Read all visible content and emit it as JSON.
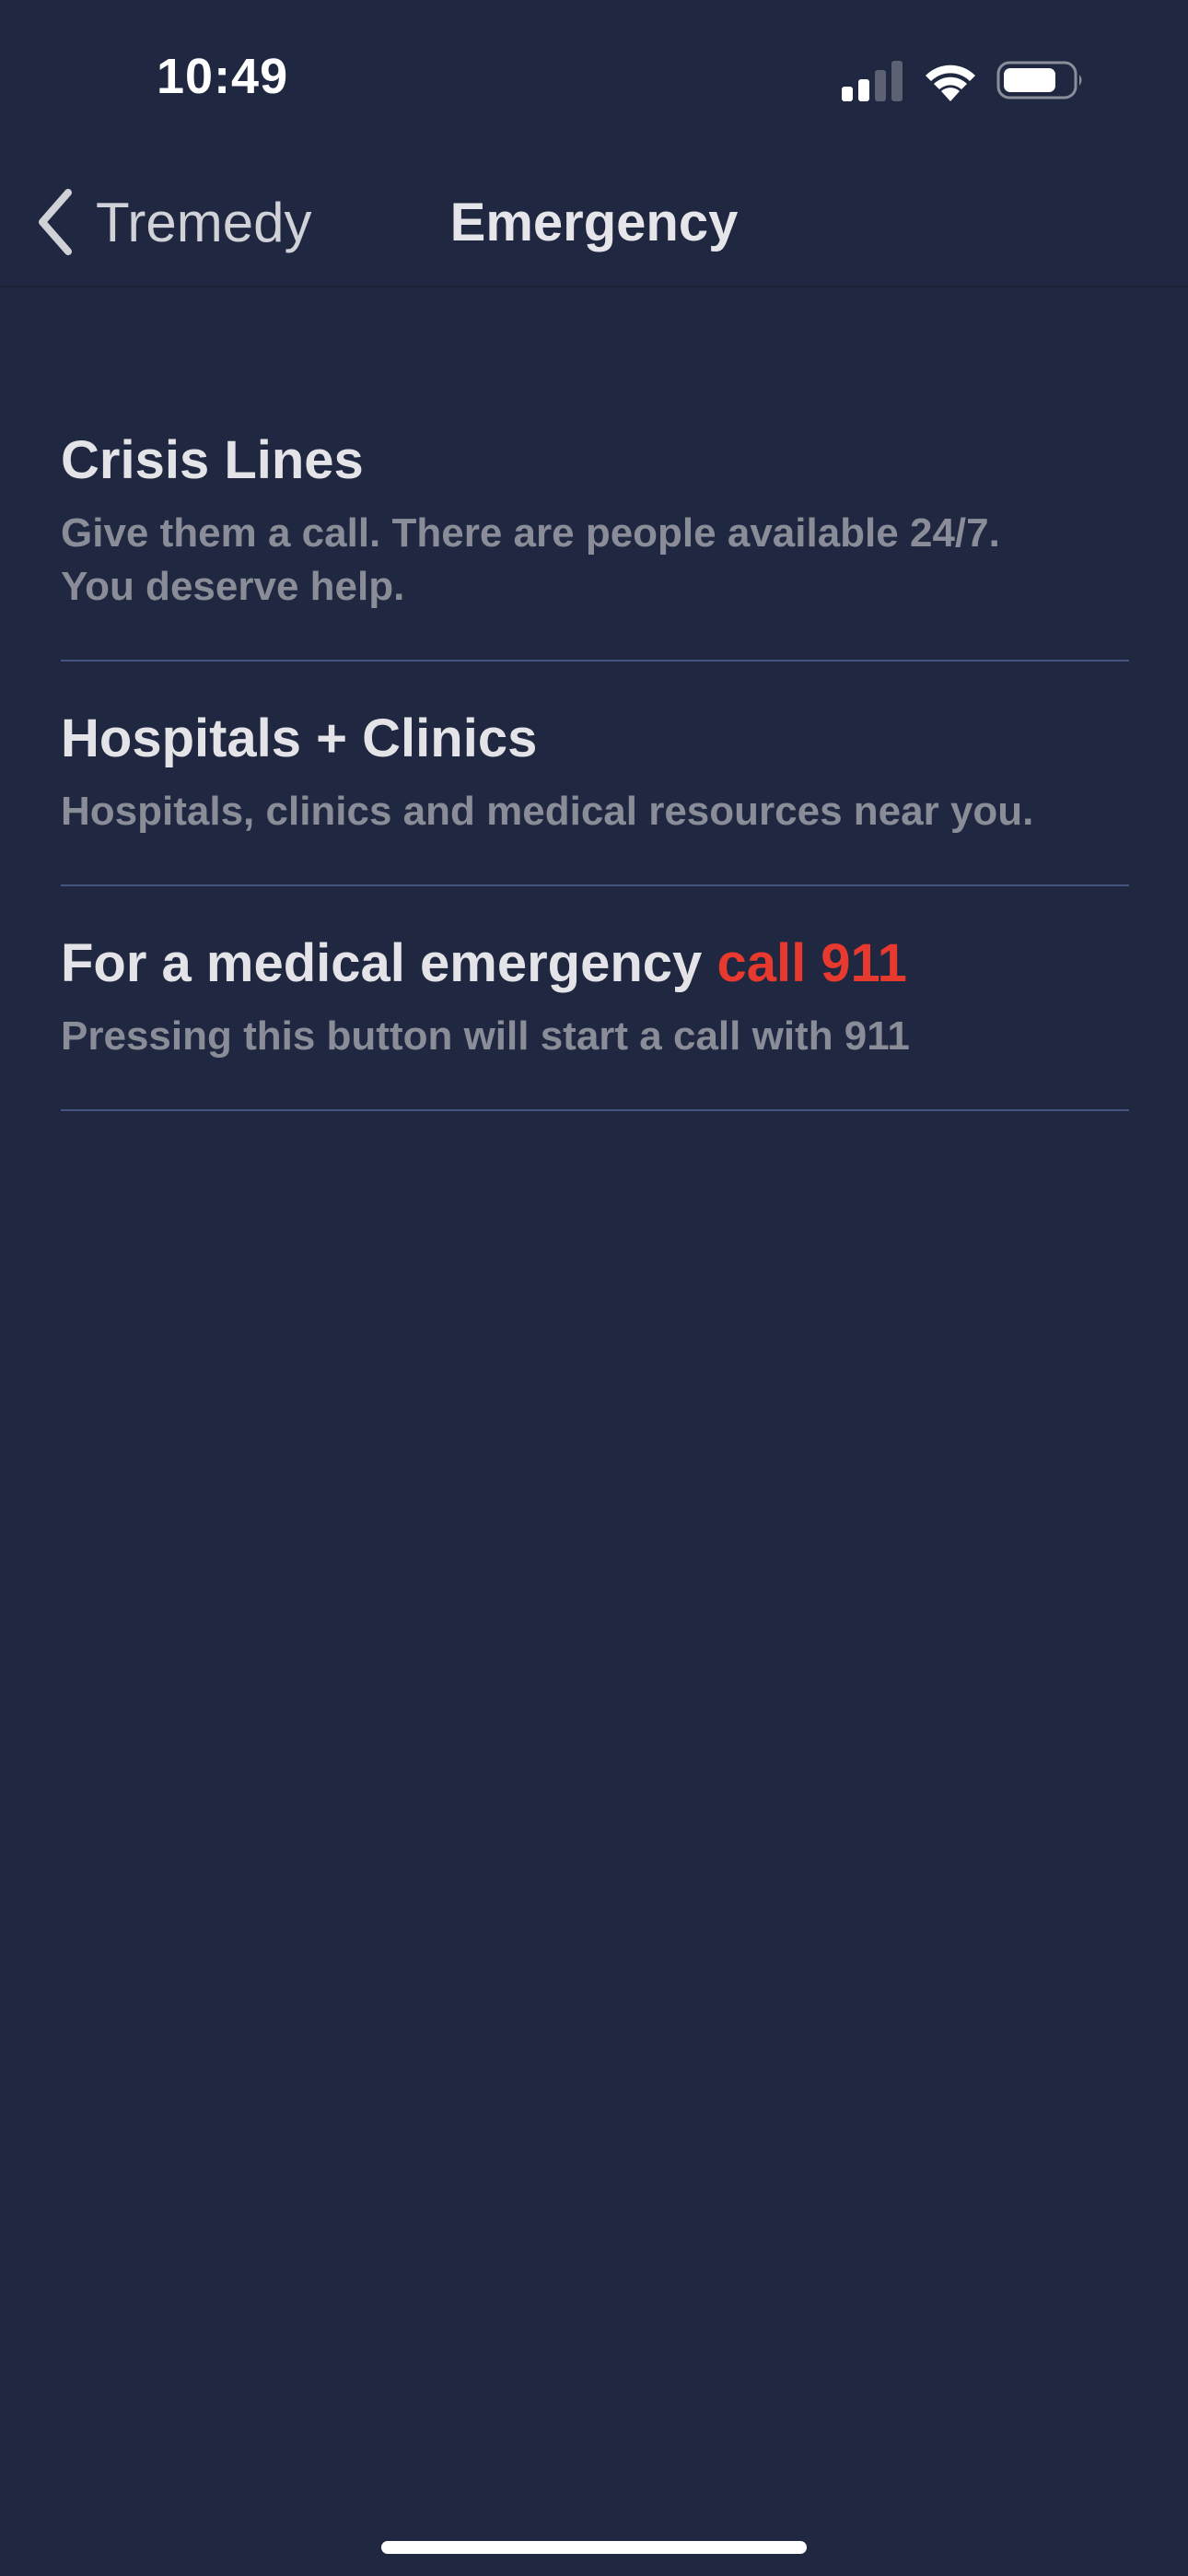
{
  "status_bar": {
    "time": "10:49",
    "icons": [
      "cellular-signal-icon",
      "wifi-icon",
      "battery-icon"
    ]
  },
  "nav": {
    "back_label": "Tremedy",
    "title": "Emergency",
    "back_icon": "chevron-left-icon"
  },
  "items": [
    {
      "title": "Crisis Lines",
      "subtitle_line1": "Give them a call. There are people available 24/7.",
      "subtitle_line2": "You deserve help."
    },
    {
      "title": "Hospitals + Clinics",
      "subtitle": "Hospitals, clinics and medical resources near you."
    },
    {
      "title_prefix": "For a medical emergency",
      "title_highlight": "call 911",
      "subtitle": "Pressing this button will start a call with 911"
    }
  ],
  "colors": {
    "background": "#1f2840",
    "divider": "#44557e",
    "danger": "#e8392f",
    "subtitle": "#8a8d97"
  }
}
